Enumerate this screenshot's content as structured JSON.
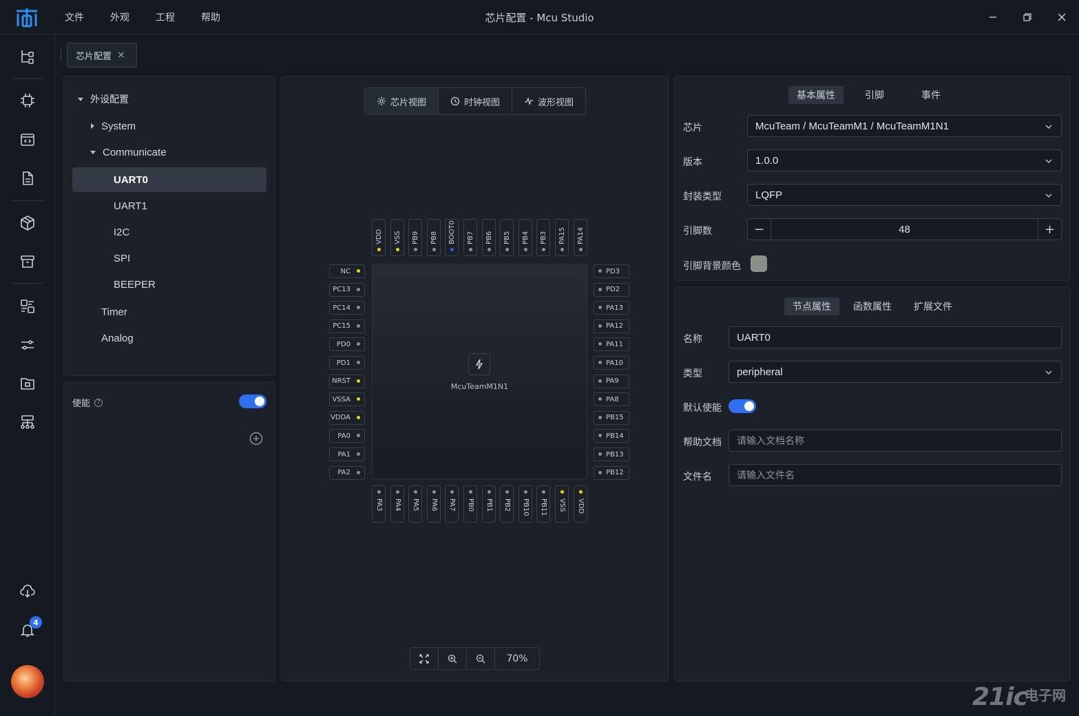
{
  "titlebar": {
    "menu": [
      "文件",
      "外观",
      "工程",
      "帮助"
    ],
    "title": "芯片配置 - Mcu Studio"
  },
  "sidebar": {
    "icons": [
      "tree-icon",
      "chip-icon",
      "code-window-icon",
      "document-icon",
      "package-icon",
      "archive-icon",
      "component-icon",
      "sliders-icon",
      "folder-icon",
      "hierarchy-icon",
      "cloud-download-icon",
      "bell-icon"
    ],
    "notification_count": "4"
  },
  "doc_tab": {
    "label": "芯片配置",
    "close": "×"
  },
  "tree": {
    "root": "外设配置",
    "items": [
      {
        "label": "System",
        "level": 1,
        "caret": "right"
      },
      {
        "label": "Communicate",
        "level": 1,
        "caret": "down"
      },
      {
        "label": "UART0",
        "level": 2,
        "selected": true
      },
      {
        "label": "UART1",
        "level": 2
      },
      {
        "label": "I2C",
        "level": 2
      },
      {
        "label": "SPI",
        "level": 2
      },
      {
        "label": "BEEPER",
        "level": 2
      },
      {
        "label": "Timer",
        "level": 1
      },
      {
        "label": "Analog",
        "level": 1
      }
    ]
  },
  "enable_panel": {
    "label": "使能",
    "help": "?",
    "enabled": true
  },
  "view_switch": [
    "芯片视图",
    "时钟视图",
    "波形视图"
  ],
  "chip": {
    "name": "McuTeamM1N1",
    "top_pins": [
      {
        "label": "VDD",
        "color": "#e8d21a"
      },
      {
        "label": "VSS",
        "color": "#e8d21a"
      },
      {
        "label": "PB9",
        "color": "#8a8f96"
      },
      {
        "label": "PB8",
        "color": "#8a8f96"
      },
      {
        "label": "BOOT0",
        "color": "#2f5cf0"
      },
      {
        "label": "PB7",
        "color": "#8a8f96"
      },
      {
        "label": "PB6",
        "color": "#8a8f96"
      },
      {
        "label": "PB5",
        "color": "#8a8f96"
      },
      {
        "label": "PB4",
        "color": "#8a8f96"
      },
      {
        "label": "PB3",
        "color": "#8a8f96"
      },
      {
        "label": "PA15",
        "color": "#8a8f96"
      },
      {
        "label": "PA14",
        "color": "#8a8f96"
      }
    ],
    "left_pins": [
      {
        "label": "NC",
        "color": "#e8d21a"
      },
      {
        "label": "PC13",
        "color": "#8a8f96"
      },
      {
        "label": "PC14",
        "color": "#8a8f96"
      },
      {
        "label": "PC15",
        "color": "#8a8f96"
      },
      {
        "label": "PD0",
        "color": "#8a8f96"
      },
      {
        "label": "PD1",
        "color": "#8a8f96"
      },
      {
        "label": "NRST",
        "color": "#e8d21a"
      },
      {
        "label": "VSSA",
        "color": "#e8d21a"
      },
      {
        "label": "VDDA",
        "color": "#e8d21a"
      },
      {
        "label": "PA0",
        "color": "#8a8f96"
      },
      {
        "label": "PA1",
        "color": "#8a8f96"
      },
      {
        "label": "PA2",
        "color": "#8a8f96"
      }
    ],
    "right_pins": [
      {
        "label": "PD3",
        "color": "#8a8f96"
      },
      {
        "label": "PD2",
        "color": "#8a8f96"
      },
      {
        "label": "PA13",
        "color": "#8a8f96"
      },
      {
        "label": "PA12",
        "color": "#8a8f96"
      },
      {
        "label": "PA11",
        "color": "#8a8f96"
      },
      {
        "label": "PA10",
        "color": "#8a8f96"
      },
      {
        "label": "PA9",
        "color": "#8a8f96"
      },
      {
        "label": "PA8",
        "color": "#8a8f96"
      },
      {
        "label": "PB15",
        "color": "#8a8f96"
      },
      {
        "label": "PB14",
        "color": "#8a8f96"
      },
      {
        "label": "PB13",
        "color": "#8a8f96"
      },
      {
        "label": "PB12",
        "color": "#8a8f96"
      }
    ],
    "bottom_pins": [
      {
        "label": "PA3",
        "color": "#8a8f96"
      },
      {
        "label": "PA4",
        "color": "#8a8f96"
      },
      {
        "label": "PA5",
        "color": "#8a8f96"
      },
      {
        "label": "PA6",
        "color": "#8a8f96"
      },
      {
        "label": "PA7",
        "color": "#8a8f96"
      },
      {
        "label": "PB0",
        "color": "#8a8f96"
      },
      {
        "label": "PB1",
        "color": "#8a8f96"
      },
      {
        "label": "PB2",
        "color": "#8a8f96"
      },
      {
        "label": "PB10",
        "color": "#8a8f96"
      },
      {
        "label": "PB11",
        "color": "#8a8f96"
      },
      {
        "label": "VSS",
        "color": "#e8d21a"
      },
      {
        "label": "VDD",
        "color": "#e8d21a"
      }
    ]
  },
  "zoom": {
    "level": "70%"
  },
  "basic_props": {
    "tabs": [
      "基本属性",
      "引脚",
      "事件"
    ],
    "chip_label": "芯片",
    "chip_value": "McuTeam / McuTeamM1 / McuTeamM1N1",
    "version_label": "版本",
    "version_value": "1.0.0",
    "package_label": "封装类型",
    "package_value": "LQFP",
    "pin_count_label": "引脚数",
    "pin_count_value": "48",
    "pin_bg_label": "引脚背景颜色",
    "pin_bg_color": "#8a8f8a"
  },
  "node_props": {
    "tabs": [
      "节点属性",
      "函数属性",
      "扩展文件"
    ],
    "name_label": "名称",
    "name_value": "UART0",
    "type_label": "类型",
    "type_value": "peripheral",
    "default_enable_label": "默认使能",
    "default_enable": true,
    "help_doc_label": "帮助文档",
    "help_doc_placeholder": "请输入文档名称",
    "file_name_label": "文件名",
    "file_name_placeholder": "请输入文件名"
  },
  "watermark": {
    "brand": "21ic",
    "sub": "电子网"
  }
}
